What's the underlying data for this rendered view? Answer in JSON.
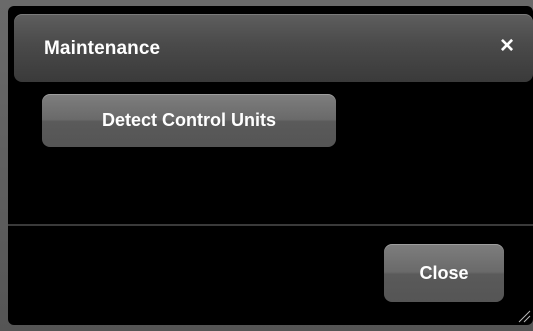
{
  "dialog": {
    "title": "Maintenance",
    "close_icon": "×",
    "actions": {
      "detect_label": "Detect Control Units"
    },
    "footer": {
      "close_label": "Close"
    }
  },
  "icons": {
    "close": "close-icon",
    "resize": "resize-grip-icon"
  }
}
